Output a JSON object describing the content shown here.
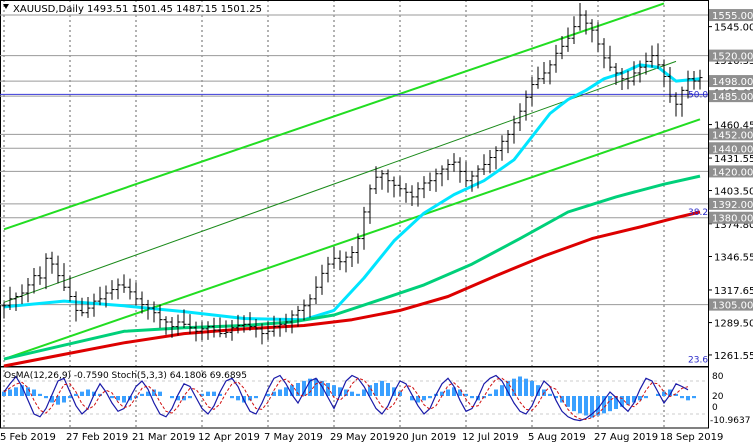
{
  "chart_data": {
    "type": "line",
    "symbol": "XAUUSD",
    "timeframe": "Daily",
    "header_values": "1493.51 1501.45 1487.15 1501.25",
    "x_labels": [
      "5 Feb 2019",
      "27 Feb 2019",
      "21 Mar 2019",
      "12 Apr 2019",
      "7 May 2019",
      "29 May 2019",
      "20 Jun 2019",
      "12 Jul 2019",
      "5 Aug 2019",
      "27 Aug 2019",
      "18 Sep 2019"
    ],
    "y_ticks": [
      "1545.00",
      "1516.35",
      "1488.05",
      "1460.45",
      "1431.55",
      "1403.50",
      "1374.80",
      "1346.55",
      "1317.65",
      "1289.50",
      "1261.55"
    ],
    "price_levels": [
      {
        "label": "1555.00",
        "value": 1555.0
      },
      {
        "label": "1520.00",
        "value": 1520.0
      },
      {
        "label": "1498.00",
        "value": 1498.0
      },
      {
        "label": "1485.00",
        "value": 1485.0
      },
      {
        "label": "1452.00",
        "value": 1452.0
      },
      {
        "label": "1440.00",
        "value": 1440.0
      },
      {
        "label": "1420.00",
        "value": 1420.0
      },
      {
        "label": "1392.00",
        "value": 1392.0
      },
      {
        "label": "1380.00",
        "value": 1380.0
      },
      {
        "label": "1305.00",
        "value": 1305.0
      }
    ],
    "fib_labels": [
      {
        "label": "50.0",
        "value": 1486.5
      },
      {
        "label": "38.2",
        "value": 1385.0
      },
      {
        "label": "23.6",
        "value": 1257.5
      }
    ],
    "close_series": [
      1304,
      1310,
      1312,
      1315,
      1322,
      1330,
      1328,
      1345,
      1340,
      1330,
      1320,
      1312,
      1300,
      1298,
      1302,
      1308,
      1310,
      1315,
      1318,
      1322,
      1320,
      1316,
      1310,
      1305,
      1302,
      1298,
      1292,
      1290,
      1286,
      1290,
      1288,
      1285,
      1282,
      1284,
      1286,
      1283,
      1280,
      1281,
      1285,
      1287,
      1288,
      1286,
      1284,
      1280,
      1282,
      1286,
      1288,
      1290,
      1296,
      1300,
      1304,
      1310,
      1320,
      1332,
      1340,
      1345,
      1342,
      1346,
      1350,
      1362,
      1385,
      1405,
      1415,
      1418,
      1412,
      1408,
      1405,
      1402,
      1398,
      1405,
      1410,
      1412,
      1418,
      1422,
      1426,
      1428,
      1420,
      1412,
      1416,
      1422,
      1426,
      1432,
      1438,
      1446,
      1452,
      1462,
      1472,
      1484,
      1495,
      1500,
      1505,
      1512,
      1522,
      1528,
      1535,
      1545,
      1555,
      1548,
      1542,
      1530,
      1518,
      1510,
      1505,
      1500,
      1498,
      1505,
      1510,
      1515,
      1520,
      1512,
      1502,
      1485,
      1478,
      1490,
      1500,
      1498,
      1501
    ],
    "ma_lines": [
      {
        "name": "ma_fast",
        "color": "#00e5ff",
        "points": [
          [
            0,
            1303
          ],
          [
            10,
            1308
          ],
          [
            20,
            1304
          ],
          [
            30,
            1299
          ],
          [
            40,
            1293
          ],
          [
            50,
            1292
          ],
          [
            55,
            1300
          ],
          [
            60,
            1328
          ],
          [
            65,
            1360
          ],
          [
            70,
            1384
          ],
          [
            75,
            1400
          ],
          [
            80,
            1412
          ],
          [
            85,
            1430
          ],
          [
            88,
            1450
          ],
          [
            91,
            1470
          ],
          [
            94,
            1482
          ],
          [
            97,
            1490
          ],
          [
            100,
            1500
          ],
          [
            103,
            1505
          ],
          [
            106,
            1512
          ],
          [
            109,
            1510
          ],
          [
            112,
            1498
          ],
          [
            116,
            1500
          ]
        ]
      },
      {
        "name": "ma_mid",
        "color": "#00d07a",
        "points": [
          [
            0,
            1258
          ],
          [
            10,
            1270
          ],
          [
            20,
            1282
          ],
          [
            30,
            1285
          ],
          [
            40,
            1287
          ],
          [
            48,
            1290
          ],
          [
            55,
            1296
          ],
          [
            62,
            1308
          ],
          [
            70,
            1322
          ],
          [
            78,
            1340
          ],
          [
            86,
            1362
          ],
          [
            94,
            1385
          ],
          [
            102,
            1398
          ],
          [
            110,
            1409
          ],
          [
            116,
            1416
          ]
        ]
      },
      {
        "name": "ma_slow",
        "color": "#dd0000",
        "points": [
          [
            0,
            1252
          ],
          [
            10,
            1262
          ],
          [
            20,
            1272
          ],
          [
            30,
            1280
          ],
          [
            40,
            1284
          ],
          [
            50,
            1287
          ],
          [
            58,
            1292
          ],
          [
            66,
            1300
          ],
          [
            74,
            1312
          ],
          [
            82,
            1330
          ],
          [
            90,
            1347
          ],
          [
            98,
            1362
          ],
          [
            106,
            1372
          ],
          [
            112,
            1380
          ],
          [
            116,
            1385
          ]
        ]
      }
    ],
    "channel_lines": [
      {
        "name": "upper",
        "color": "#22dd22",
        "points": [
          [
            0,
            1370
          ],
          [
            110,
            1565
          ]
        ]
      },
      {
        "name": "middle",
        "color": "#1a8a1a",
        "points": [
          [
            0,
            1307
          ],
          [
            112,
            1515
          ]
        ]
      },
      {
        "name": "lower",
        "color": "#22dd22",
        "points": [
          [
            0,
            1258
          ],
          [
            116,
            1465
          ]
        ]
      }
    ],
    "ylim": [
      1252,
      1568
    ],
    "indicator": {
      "label": "OsMA(12,26,9) -0.7590  Stoch(5,3,3) 64.1806 69.6895",
      "y_labels": [
        "80",
        "20",
        "0",
        "-10.9637"
      ],
      "osma": [
        2,
        3,
        4,
        5,
        4,
        3,
        1,
        -1,
        -3,
        -4,
        -3,
        -1,
        1,
        2,
        3,
        2,
        1,
        0,
        -1,
        -2,
        -3,
        -2,
        -1,
        1,
        2,
        3,
        2,
        0,
        -1,
        -2,
        -2,
        -1,
        0,
        1,
        2,
        2,
        1,
        0,
        -1,
        -2,
        -3,
        -2,
        -1,
        0,
        1,
        2,
        3,
        4,
        5,
        6,
        7,
        8,
        8,
        7,
        6,
        5,
        4,
        3,
        2,
        1,
        3,
        5,
        6,
        7,
        6,
        4,
        2,
        0,
        -2,
        -3,
        -2,
        -1,
        1,
        2,
        3,
        4,
        3,
        1,
        -1,
        -2,
        -1,
        1,
        3,
        5,
        7,
        8,
        9,
        8,
        7,
        5,
        3,
        1,
        -1,
        -3,
        -5,
        -7,
        -8,
        -9,
        -10,
        -9,
        -8,
        -7,
        -6,
        -5,
        -4,
        -3,
        -2,
        -1,
        0,
        1,
        2,
        3,
        1,
        -1,
        -2,
        -1,
        0
      ],
      "stoch_k": [
        60,
        75,
        88,
        70,
        45,
        20,
        15,
        30,
        55,
        80,
        85,
        60,
        35,
        20,
        30,
        55,
        75,
        60,
        40,
        25,
        30,
        50,
        70,
        80,
        65,
        40,
        20,
        15,
        30,
        55,
        75,
        70,
        50,
        30,
        20,
        35,
        60,
        80,
        85,
        70,
        45,
        25,
        20,
        40,
        65,
        85,
        90,
        75,
        55,
        40,
        60,
        80,
        85,
        70,
        50,
        30,
        55,
        80,
        90,
        85,
        70,
        50,
        30,
        20,
        35,
        60,
        80,
        75,
        55,
        35,
        20,
        30,
        55,
        75,
        85,
        70,
        45,
        25,
        30,
        50,
        75,
        85,
        90,
        80,
        60,
        40,
        25,
        20,
        35,
        60,
        80,
        70,
        45,
        25,
        15,
        10,
        8,
        12,
        20,
        30,
        45,
        60,
        50,
        35,
        25,
        40,
        65,
        85,
        80,
        60,
        40,
        55,
        75,
        70,
        64
      ]
    }
  }
}
